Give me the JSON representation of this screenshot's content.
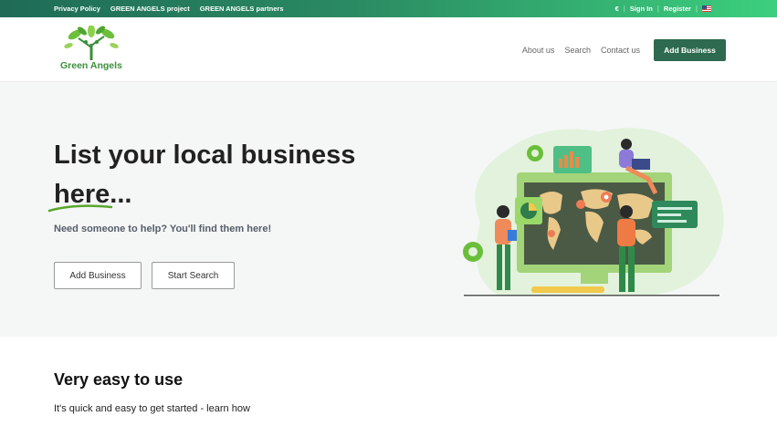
{
  "topbar": {
    "links": [
      "Privacy Policy",
      "GREEN ANGELS project",
      "GREEN ANGELS partners"
    ],
    "currency": "€",
    "sign_in": "Sign In",
    "register": "Register",
    "language_flag": "us-flag-icon"
  },
  "header": {
    "logo_text": "Green Angels",
    "nav": [
      "About us",
      "Search",
      "Contact us"
    ],
    "add_business": "Add Business"
  },
  "hero": {
    "title_line1": "List your local business",
    "title_line2": "here...",
    "subtitle": "Need someone to help? You'll find them here!",
    "btn_add": "Add Business",
    "btn_search": "Start Search"
  },
  "section": {
    "title": "Very easy to use",
    "subtitle": "It's quick and easy to get started - learn how"
  },
  "colors": {
    "topbar_start": "#1f6b56",
    "topbar_end": "#3ccf7e",
    "primary_button": "#2d6a4f",
    "brand_green": "#3b8f3b",
    "hero_bg": "#f5f6f6"
  }
}
